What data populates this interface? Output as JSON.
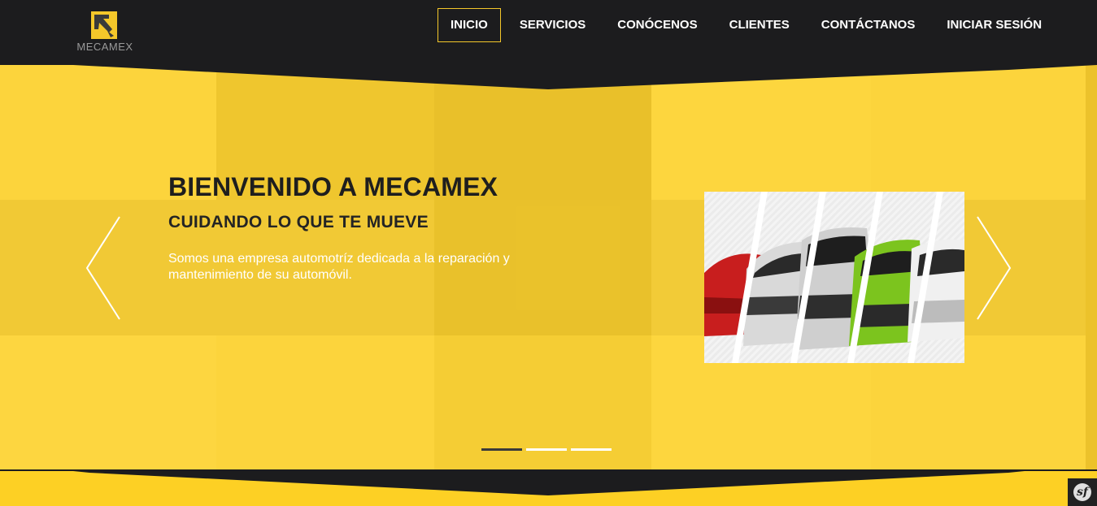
{
  "brand": {
    "name": "MECAMEX",
    "icon": "wrench-logo-icon",
    "accent": "#f4c72a"
  },
  "nav": {
    "items": [
      {
        "label": "INICIO",
        "active": true
      },
      {
        "label": "SERVICIOS",
        "active": false
      },
      {
        "label": "CONÓCENOS",
        "active": false
      },
      {
        "label": "CLIENTES",
        "active": false
      },
      {
        "label": "CONTÁCTANOS",
        "active": false
      },
      {
        "label": "INICIAR SESIÓN",
        "active": false
      }
    ]
  },
  "hero": {
    "title": "BIENVENIDO A MECAMEX",
    "subtitle": "CUIDANDO LO QUE TE MUEVE",
    "description": "Somos una empresa automotríz dedicada a la reparación y mantenimiento de su automóvil.",
    "background_color": "#fcd43c",
    "image_icon": "cars-lineup-image",
    "prev_icon": "chevron-left-icon",
    "next_icon": "chevron-right-icon",
    "slides_total": 3,
    "active_slide": 1
  },
  "debug_badge": {
    "icon": "symfony-icon",
    "label": "sf"
  }
}
